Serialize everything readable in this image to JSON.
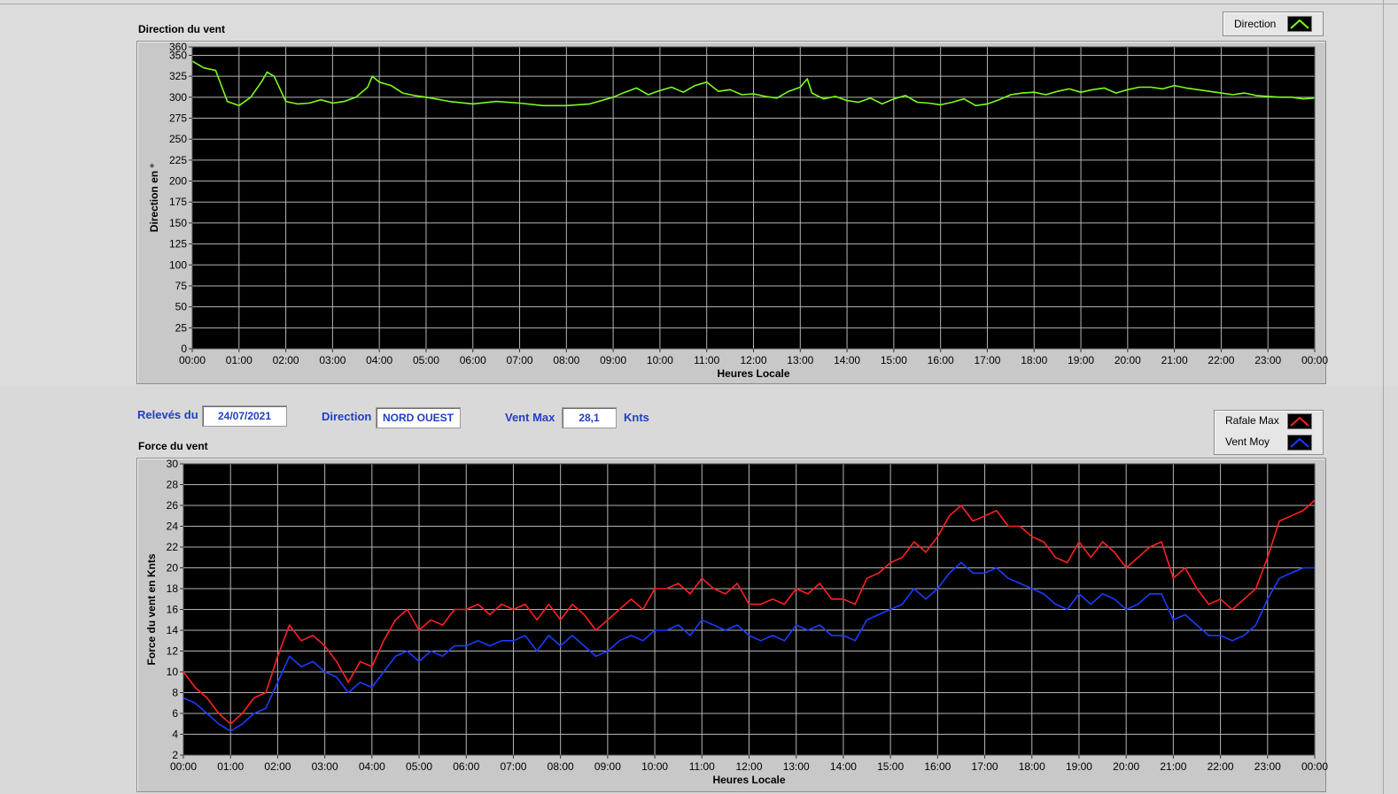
{
  "direction_panel": {
    "title": "Direction du vent",
    "legend_label": "Direction"
  },
  "force_panel": {
    "title": "Force du vent",
    "legend": [
      "Rafale Max",
      "Vent Moy"
    ]
  },
  "info": {
    "releves_label": "Relevés du",
    "date": "24/07/2021",
    "direction_label": "Direction",
    "direction_value": "NORD OUEST",
    "ventmax_label": "Vent Max",
    "ventmax_value": "28,1",
    "unit": "Knts"
  },
  "colors": {
    "background_plot": "#000000",
    "grid": "#b4b4b4",
    "direction_line": "#7cfc1e",
    "gust_line": "#ff2020",
    "mean_line": "#1a3cff",
    "label_blue": "#1f3fc4"
  },
  "chart_data": [
    {
      "type": "line",
      "title": "Direction du vent",
      "xlabel": "Heures Locale",
      "ylabel": "Direction en °",
      "x_ticks": [
        "00:00",
        "01:00",
        "02:00",
        "03:00",
        "04:00",
        "05:00",
        "06:00",
        "07:00",
        "08:00",
        "09:00",
        "10:00",
        "11:00",
        "12:00",
        "13:00",
        "14:00",
        "15:00",
        "16:00",
        "17:00",
        "18:00",
        "19:00",
        "20:00",
        "21:00",
        "22:00",
        "23:00",
        "00:00"
      ],
      "y_ticks": [
        0,
        25,
        50,
        75,
        100,
        125,
        150,
        175,
        200,
        225,
        250,
        275,
        300,
        325,
        350,
        360
      ],
      "ylim": [
        0,
        360
      ],
      "xlim_hours": [
        0,
        24
      ],
      "grid": true,
      "series": [
        {
          "name": "Direction",
          "color": "#7cfc1e",
          "x_hours": [
            0,
            0.25,
            0.5,
            0.75,
            1,
            1.25,
            1.5,
            1.6,
            1.75,
            2,
            2.25,
            2.5,
            2.75,
            3,
            3.25,
            3.5,
            3.75,
            3.85,
            4,
            4.25,
            4.5,
            4.75,
            5,
            5.5,
            6,
            6.5,
            7,
            7.5,
            8,
            8.5,
            9,
            9.25,
            9.5,
            9.75,
            10,
            10.25,
            10.5,
            10.75,
            11,
            11.25,
            11.5,
            11.75,
            12,
            12.25,
            12.5,
            12.75,
            13,
            13.15,
            13.25,
            13.5,
            13.75,
            14,
            14.25,
            14.5,
            14.75,
            15,
            15.25,
            15.5,
            15.75,
            16,
            16.25,
            16.5,
            16.75,
            17,
            17.25,
            17.5,
            17.75,
            18,
            18.25,
            18.5,
            18.75,
            19,
            19.25,
            19.5,
            19.75,
            20,
            20.25,
            20.5,
            20.75,
            21,
            21.25,
            21.5,
            21.75,
            22,
            22.25,
            22.5,
            22.75,
            23,
            23.25,
            23.5,
            23.75,
            24
          ],
          "values": [
            343,
            335,
            332,
            295,
            290,
            300,
            320,
            330,
            325,
            295,
            292,
            293,
            297,
            293,
            295,
            300,
            312,
            325,
            318,
            314,
            305,
            302,
            300,
            295,
            292,
            295,
            293,
            290,
            290,
            292,
            300,
            306,
            311,
            303,
            308,
            312,
            306,
            314,
            318,
            307,
            309,
            303,
            304,
            301,
            299,
            307,
            312,
            322,
            305,
            298,
            301,
            296,
            294,
            299,
            292,
            298,
            302,
            294,
            293,
            291,
            294,
            298,
            290,
            292,
            297,
            303,
            305,
            306,
            303,
            307,
            310,
            306,
            309,
            311,
            305,
            309,
            312,
            312,
            310,
            314,
            311,
            309,
            307,
            305,
            303,
            305,
            302,
            301,
            300,
            300,
            298,
            299
          ]
        }
      ]
    },
    {
      "type": "line",
      "title": "Force du vent",
      "xlabel": "Heures Locale",
      "ylabel": "Force du vent en Knts",
      "x_ticks": [
        "00:00",
        "01:00",
        "02:00",
        "03:00",
        "04:00",
        "05:00",
        "06:00",
        "07:00",
        "08:00",
        "09:00",
        "10:00",
        "11:00",
        "12:00",
        "13:00",
        "14:00",
        "15:00",
        "16:00",
        "17:00",
        "18:00",
        "19:00",
        "20:00",
        "21:00",
        "22:00",
        "23:00",
        "00:00"
      ],
      "y_ticks": [
        2,
        4,
        6,
        8,
        10,
        12,
        14,
        16,
        18,
        20,
        22,
        24,
        26,
        28,
        30
      ],
      "ylim": [
        2,
        30
      ],
      "xlim_hours": [
        0,
        24
      ],
      "grid": true,
      "series": [
        {
          "name": "Rafale Max",
          "color": "#ff2020",
          "x_hours": [
            0,
            0.25,
            0.5,
            0.75,
            1,
            1.25,
            1.5,
            1.75,
            2,
            2.25,
            2.5,
            2.75,
            3,
            3.25,
            3.5,
            3.75,
            4,
            4.25,
            4.5,
            4.75,
            5,
            5.25,
            5.5,
            5.75,
            6,
            6.25,
            6.5,
            6.75,
            7,
            7.25,
            7.5,
            7.75,
            8,
            8.25,
            8.5,
            8.75,
            9,
            9.25,
            9.5,
            9.75,
            10,
            10.25,
            10.5,
            10.75,
            11,
            11.25,
            11.5,
            11.75,
            12,
            12.25,
            12.5,
            12.75,
            13,
            13.25,
            13.5,
            13.75,
            14,
            14.25,
            14.5,
            14.75,
            15,
            15.25,
            15.5,
            15.75,
            16,
            16.25,
            16.5,
            16.75,
            17,
            17.25,
            17.5,
            17.75,
            18,
            18.25,
            18.5,
            18.75,
            19,
            19.25,
            19.5,
            19.75,
            20,
            20.25,
            20.5,
            20.75,
            21,
            21.25,
            21.5,
            21.75,
            22,
            22.25,
            22.5,
            22.75,
            23,
            23.25,
            23.5,
            23.75,
            24
          ],
          "values": [
            10,
            8.5,
            7.5,
            6,
            5,
            6,
            7.5,
            8,
            11.5,
            14.5,
            13,
            13.5,
            12.5,
            11,
            9,
            11,
            10.5,
            13,
            15,
            16,
            14,
            15,
            14.5,
            16,
            16,
            16.5,
            15.5,
            16.5,
            16,
            16.5,
            15,
            16.5,
            15,
            16.5,
            15.5,
            14,
            15,
            16,
            17,
            16,
            18,
            18,
            18.5,
            17.5,
            19,
            18,
            17.5,
            18.5,
            16.5,
            16.5,
            17,
            16.5,
            18,
            17.5,
            18.5,
            17,
            17,
            16.5,
            19,
            19.5,
            20.5,
            21,
            22.5,
            21.5,
            23,
            25,
            26,
            24.5,
            25,
            25.5,
            24,
            24,
            23,
            22.5,
            21,
            20.5,
            22.5,
            21,
            22.5,
            21.5,
            20,
            21,
            22,
            22.5,
            19,
            20,
            18,
            16.5,
            17,
            16,
            17,
            18,
            21,
            24.5,
            25,
            25.5,
            26.5
          ]
        },
        {
          "name": "Vent Moy",
          "color": "#1a3cff",
          "x_hours": [
            0,
            0.25,
            0.5,
            0.75,
            1,
            1.25,
            1.5,
            1.75,
            2,
            2.25,
            2.5,
            2.75,
            3,
            3.25,
            3.5,
            3.75,
            4,
            4.25,
            4.5,
            4.75,
            5,
            5.25,
            5.5,
            5.75,
            6,
            6.25,
            6.5,
            6.75,
            7,
            7.25,
            7.5,
            7.75,
            8,
            8.25,
            8.5,
            8.75,
            9,
            9.25,
            9.5,
            9.75,
            10,
            10.25,
            10.5,
            10.75,
            11,
            11.25,
            11.5,
            11.75,
            12,
            12.25,
            12.5,
            12.75,
            13,
            13.25,
            13.5,
            13.75,
            14,
            14.25,
            14.5,
            14.75,
            15,
            15.25,
            15.5,
            15.75,
            16,
            16.25,
            16.5,
            16.75,
            17,
            17.25,
            17.5,
            17.75,
            18,
            18.25,
            18.5,
            18.75,
            19,
            19.25,
            19.5,
            19.75,
            20,
            20.25,
            20.5,
            20.75,
            21,
            21.25,
            21.5,
            21.75,
            22,
            22.25,
            22.5,
            22.75,
            23,
            23.25,
            23.5,
            23.75,
            24
          ],
          "values": [
            7.5,
            7,
            6,
            5,
            4.3,
            5,
            6,
            6.5,
            9,
            11.5,
            10.5,
            11,
            10,
            9.5,
            8,
            9,
            8.5,
            10,
            11.5,
            12,
            11,
            12,
            11.5,
            12.5,
            12.5,
            13,
            12.5,
            13,
            13,
            13.5,
            12,
            13.5,
            12.5,
            13.5,
            12.5,
            11.5,
            12,
            13,
            13.5,
            13,
            14,
            14,
            14.5,
            13.5,
            15,
            14.5,
            14,
            14.5,
            13.5,
            13,
            13.5,
            13,
            14.5,
            14,
            14.5,
            13.5,
            13.5,
            13,
            15,
            15.5,
            16,
            16.5,
            18,
            17,
            18,
            19.5,
            20.5,
            19.5,
            19.5,
            20,
            19,
            18.5,
            18,
            17.5,
            16.5,
            16,
            17.5,
            16.5,
            17.5,
            17,
            16,
            16.5,
            17.5,
            17.5,
            15,
            15.5,
            14.5,
            13.5,
            13.5,
            13,
            13.5,
            14.5,
            17,
            19,
            19.5,
            20,
            20
          ]
        }
      ]
    }
  ]
}
